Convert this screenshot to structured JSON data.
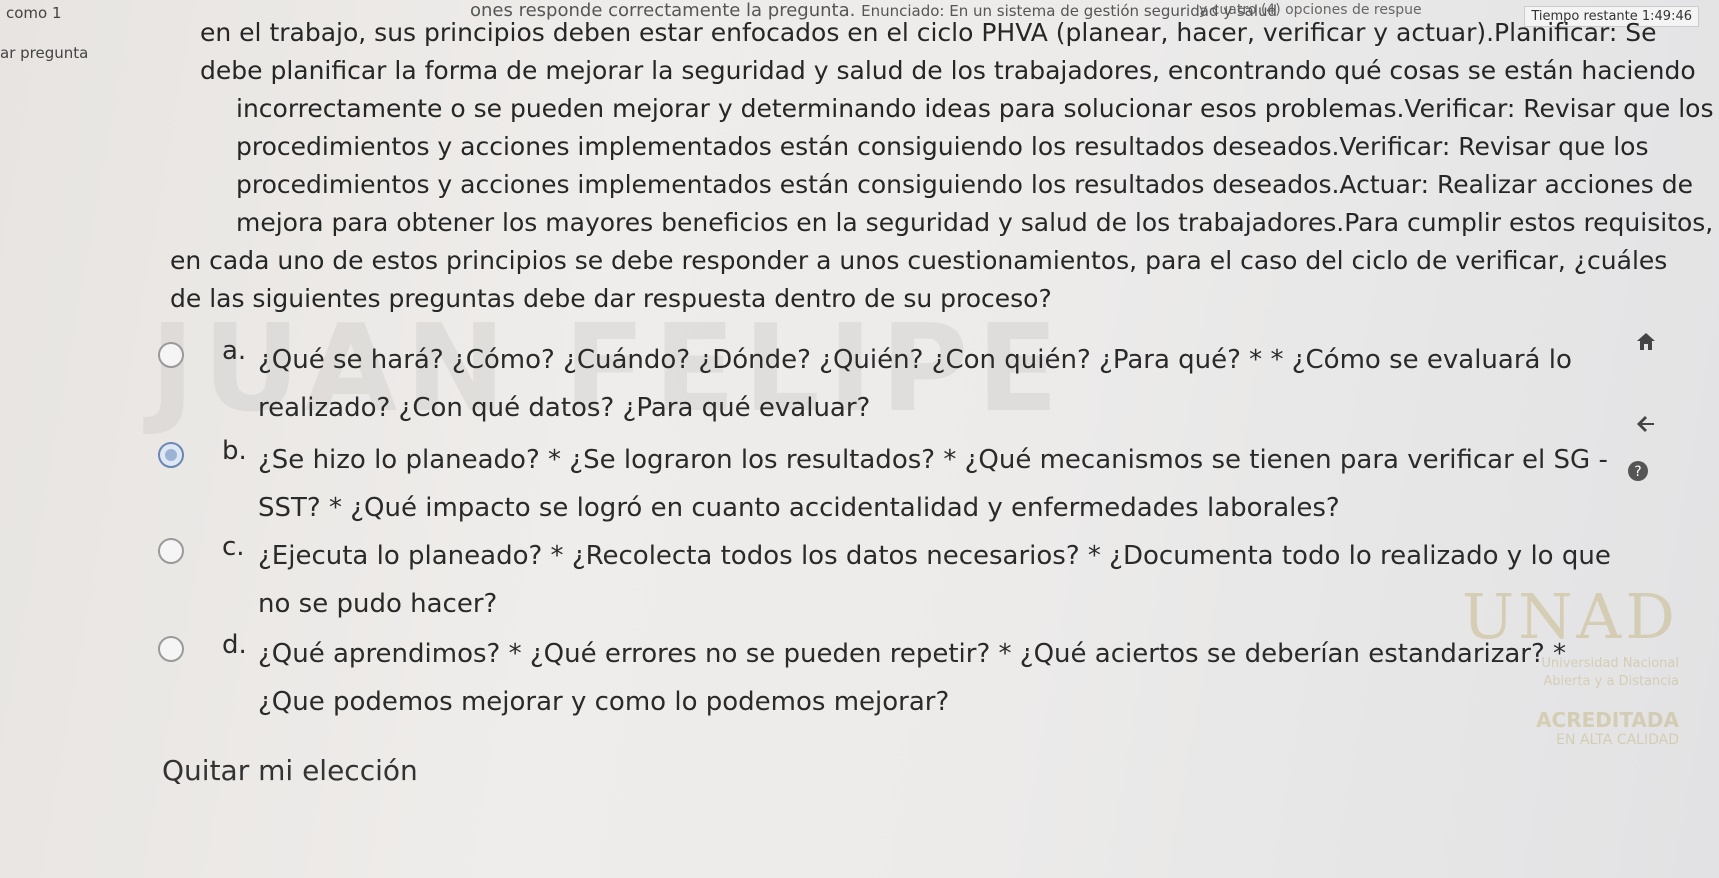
{
  "left_col": {
    "line1": "como 1",
    "line2": "ar pregunta"
  },
  "header": {
    "instruction_fragment": "ones responde correctamente la pregunta.",
    "options_hint": "y cuatro (4) opciones de respue",
    "timer": "Tiempo restante 1:49:46"
  },
  "question": {
    "lines": [
      "en el trabajo, sus principios deben estar enfocados en el ciclo PHVA (planear, hacer, verificar y actuar).Planificar: Se",
      "debe planificar la forma de mejorar la seguridad y salud de los trabajadores, encontrando qué cosas se están haciendo",
      "incorrectamente o se pueden mejorar y determinando ideas para solucionar esos problemas.Verificar: Revisar que los",
      "procedimientos y acciones implementados están consiguiendo los resultados deseados.Verificar: Revisar que los",
      "procedimientos y acciones implementados están consiguiendo los resultados deseados.Actuar: Realizar acciones de",
      "mejora para obtener los mayores beneficios en la seguridad y salud de los trabajadores.Para cumplir estos requisitos,",
      "en cada uno de estos principios se debe responder a unos cuestionamientos, para el caso del ciclo de verificar, ¿cuáles",
      "de las siguientes preguntas debe dar respuesta dentro de su proceso?"
    ],
    "prefix": "Enunciado: En un sistema de gestión seguridad y salud"
  },
  "options": [
    {
      "letter": "a.",
      "text": "¿Qué se hará? ¿Cómo? ¿Cuándo? ¿Dónde? ¿Quién? ¿Con quién? ¿Para qué? * * ¿Cómo se evaluará lo realizado? ¿Con qué datos? ¿Para qué evaluar?",
      "selected": false
    },
    {
      "letter": "b.",
      "text": "¿Se hizo lo planeado? * ¿Se lograron los resultados? * ¿Qué mecanismos se tienen para verificar el SG - SST? * ¿Qué impacto se logró en cuanto accidentalidad y enfermedades laborales?",
      "selected": true
    },
    {
      "letter": "c.",
      "text": "¿Ejecuta lo planeado? * ¿Recolecta todos los datos necesarios? * ¿Documenta todo lo realizado y lo que no se pudo hacer?",
      "selected": false
    },
    {
      "letter": "d.",
      "text": "¿Qué aprendimos? * ¿Qué errores no se pueden repetir? * ¿Qué aciertos se deberían estandarizar? * ¿Que podemos mejorar y como lo podemos mejorar?",
      "selected": false
    }
  ],
  "clear_choice": "Quitar mi elección",
  "watermark": {
    "logo": "UNAD",
    "line1": "Universidad Nacional",
    "line2": "Abierta y a Distancia",
    "accred": "ACREDITADA",
    "quality": "EN ALTA CALIDAD"
  },
  "bg_watermark": "JUAN FELIPE",
  "icons": {
    "home": "home-icon",
    "back": "back-arrow-icon",
    "help": "help-icon"
  }
}
